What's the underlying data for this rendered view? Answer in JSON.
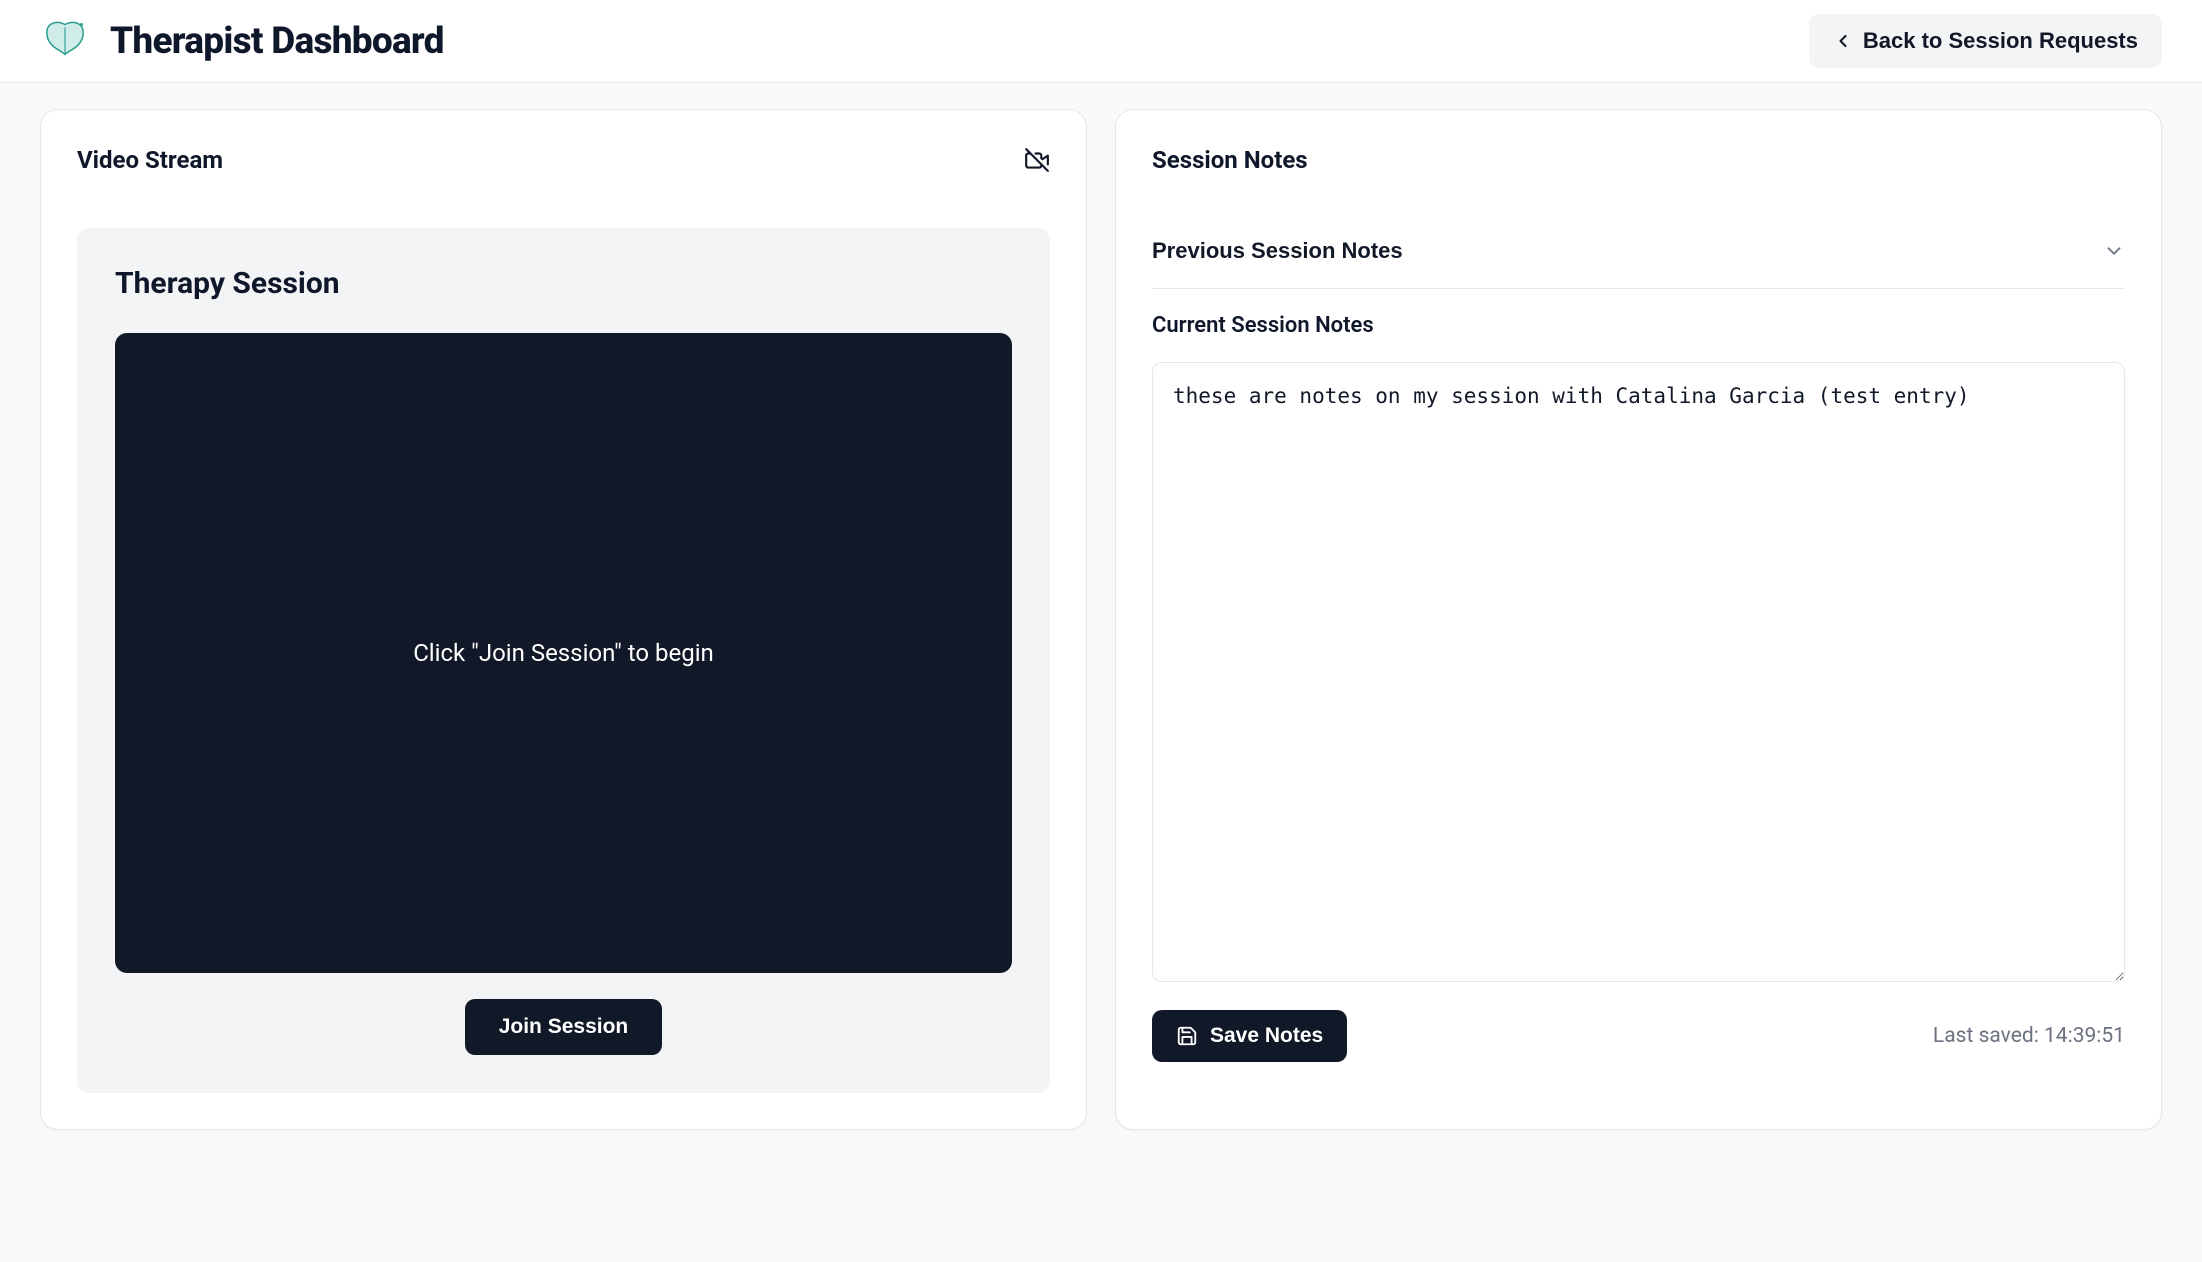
{
  "header": {
    "title": "Therapist Dashboard",
    "back_button_label": "Back to Session Requests"
  },
  "video_card": {
    "title": "Video Stream",
    "session_panel_title": "Therapy Session",
    "video_placeholder": "Click \"Join Session\" to begin",
    "join_button_label": "Join Session"
  },
  "notes_card": {
    "title": "Session Notes",
    "previous_notes_label": "Previous Session Notes",
    "current_notes_label": "Current Session Notes",
    "current_notes_value": "these are notes on my session with Catalina Garcia (test entry)",
    "save_button_label": "Save Notes",
    "last_saved_prefix": "Last saved: ",
    "last_saved_time": "14:39:51"
  }
}
